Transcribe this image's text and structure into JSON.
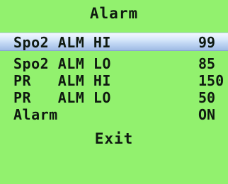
{
  "menu": {
    "title": "Alarm",
    "items": [
      {
        "label": "Spo2 ALM HI",
        "value": "99"
      },
      {
        "label": "Spo2 ALM LO",
        "value": "85"
      },
      {
        "label": "PR   ALM HI",
        "value": "150"
      },
      {
        "label": "PR   ALM LO",
        "value": "50"
      },
      {
        "label": "Alarm",
        "value": "ON"
      }
    ],
    "exit_label": "Exit",
    "selected_index": 0
  },
  "colors": {
    "background": "#92f16e",
    "text": "#0f1a10",
    "highlight": "#bcd3f2"
  }
}
